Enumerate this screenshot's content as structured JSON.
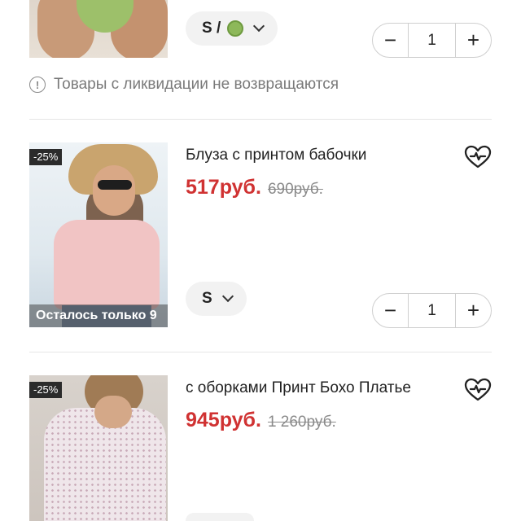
{
  "items": [
    {
      "variant_size": "S /",
      "quantity": "1",
      "notice": "Товары с ликвидации не возвращаются"
    },
    {
      "title": "Блуза с принтом бабочки",
      "price_now": "517руб.",
      "price_old": "690руб.",
      "discount": "-25%",
      "stock": "Осталось только 9",
      "variant_size": "S",
      "quantity": "1"
    },
    {
      "title": "с оборками Принт Бохо Платье",
      "price_now": "945руб.",
      "price_old": "1 260руб.",
      "discount": "-25%"
    }
  ],
  "icons": {
    "info": "info-circle-icon",
    "wishlist": "heart-plus-icon",
    "chevron": "chevron-down-icon",
    "minus": "minus-icon",
    "plus": "plus-icon",
    "color_swatch": "green-color-swatch-icon"
  },
  "colors": {
    "price_red": "#d03232",
    "discount_badge": "#2b2b2b",
    "pill_bg": "#f2f2f2"
  }
}
